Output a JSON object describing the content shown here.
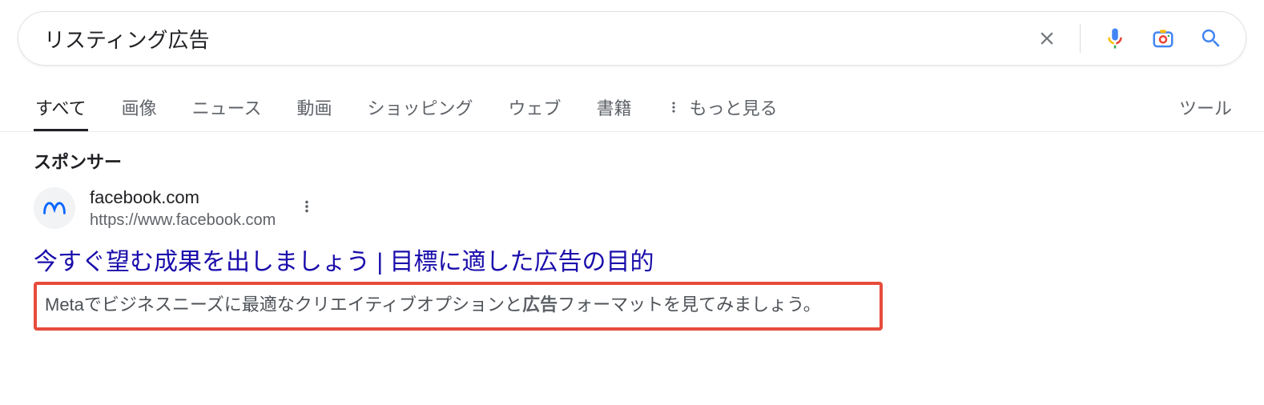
{
  "search": {
    "query": "リスティング広告"
  },
  "tabs": {
    "all": "すべて",
    "images": "画像",
    "news": "ニュース",
    "videos": "動画",
    "shopping": "ショッピング",
    "web": "ウェブ",
    "books": "書籍",
    "more": "もっと見る",
    "tools": "ツール"
  },
  "result": {
    "sponsor_label": "スポンサー",
    "site_name": "facebook.com",
    "site_url": "https://www.facebook.com",
    "title": "今すぐ望む成果を出しましょう | 目標に適した広告の目的",
    "desc_prefix": "Metaでビジネスニーズに最適なクリエイティブオプションと",
    "desc_bold": "広告",
    "desc_suffix": "フォーマットを見てみましょう。"
  }
}
